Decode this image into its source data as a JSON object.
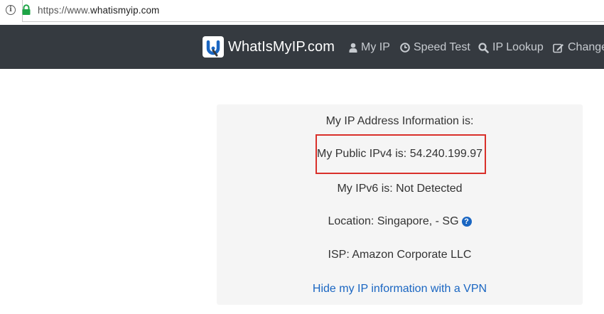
{
  "browser": {
    "url_scheme": "https://www.",
    "url_host": "whatismyip.com"
  },
  "navbar": {
    "brand": "WhatIsMyIP.com",
    "items": [
      {
        "label": "My IP",
        "icon": "user-icon"
      },
      {
        "label": "Speed Test",
        "icon": "clock-icon"
      },
      {
        "label": "IP Lookup",
        "icon": "search-icon"
      },
      {
        "label": "Change",
        "icon": "edit-icon"
      }
    ]
  },
  "panel": {
    "heading": "My IP Address Information is:",
    "ipv4": "My Public IPv4 is: 54.240.199.97",
    "ipv6": "My IPv6 is: Not Detected",
    "location": "Location: Singapore, - SG",
    "isp": "ISP: Amazon Corporate LLC",
    "vpn_link": "Hide my IP information with a VPN"
  },
  "colors": {
    "navbar_bg": "#353a40",
    "link": "#1a66c2",
    "highlight_border": "#d9302a",
    "panel_bg": "#f5f5f5"
  }
}
